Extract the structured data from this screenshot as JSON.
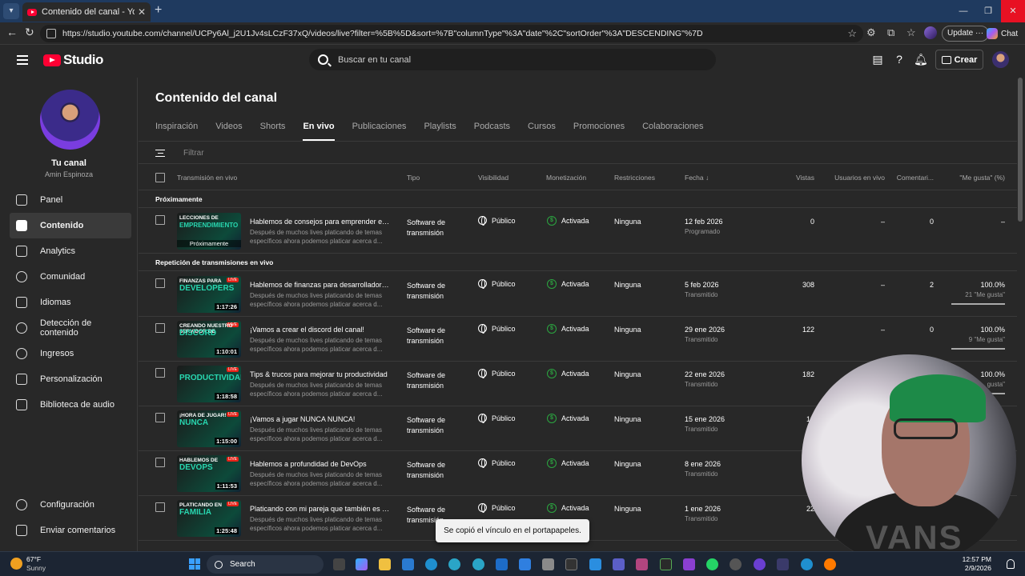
{
  "browser": {
    "tab_title": "Contenido del canal - YouTube Studio",
    "url": "https://studio.youtube.com/channel/UCPy6Al_j2U1Jv4sLCzF37xQ/videos/live?filter=%5B%5D&sort=%7B\"columnType\"%3A\"date\"%2C\"sortOrder\"%3A\"DESCENDING\"%7D",
    "update_label": "Update",
    "chat_label": "Chat"
  },
  "header": {
    "logo": "Studio",
    "search_placeholder": "Buscar en tu canal",
    "create_label": "Crear"
  },
  "sidebar": {
    "channel_title": "Tu canal",
    "channel_name": "Amin Espinoza",
    "items": [
      {
        "label": "Panel",
        "icon": "dashboard-icon"
      },
      {
        "label": "Contenido",
        "icon": "content-icon",
        "active": true
      },
      {
        "label": "Analytics",
        "icon": "analytics-icon"
      },
      {
        "label": "Comunidad",
        "icon": "community-icon"
      },
      {
        "label": "Idiomas",
        "icon": "languages-icon"
      },
      {
        "label": "Detección de contenido",
        "icon": "content-detection-icon"
      },
      {
        "label": "Ingresos",
        "icon": "earn-icon"
      },
      {
        "label": "Personalización",
        "icon": "customization-icon"
      },
      {
        "label": "Biblioteca de audio",
        "icon": "audio-library-icon"
      }
    ],
    "bottom": [
      {
        "label": "Configuración",
        "icon": "settings-icon"
      },
      {
        "label": "Enviar comentarios",
        "icon": "feedback-icon"
      }
    ]
  },
  "main": {
    "title": "Contenido del canal",
    "tabs": [
      "Inspiración",
      "Videos",
      "Shorts",
      "En vivo",
      "Publicaciones",
      "Playlists",
      "Podcasts",
      "Cursos",
      "Promociones",
      "Colaboraciones"
    ],
    "active_tab": "En vivo",
    "filter_placeholder": "Filtrar",
    "columns": [
      "Transmisión en vivo",
      "Tipo",
      "Visibilidad",
      "Monetización",
      "Restricciones",
      "Fecha",
      "Vistas",
      "Usuarios en vivo",
      "Comentari...",
      "\"Me gusta\" (%)"
    ],
    "section_upcoming": "Próximamente",
    "section_replays": "Repetición de transmisiones en vivo",
    "upcoming": [
      {
        "title": "Hablemos de consejos para emprender en...",
        "desc": "Después de muchos lives platicando de temas específicos ahora podemos platicar acerca d...",
        "thumb_top": "LECCIONES DE",
        "thumb_big": "EMPRENDIMIENTO",
        "thumb_badge": "Próximamente",
        "type": "Software de transmisión",
        "visibility": "Público",
        "monetization": "Activada",
        "restrictions": "Ninguna",
        "date": "12 feb 2026",
        "state": "Programado",
        "views": "0",
        "live_users": "–",
        "comments": "0",
        "likes": "–"
      }
    ],
    "replays": [
      {
        "title": "Hablemos de finanzas para desarrolladore...",
        "desc": "Después de muchos lives platicando de temas específicos ahora podemos platicar acerca d...",
        "thumb_top": "FINANZAS PARA",
        "thumb_big": "DEVELOPERS",
        "duration": "1:17:26",
        "type": "Software de transmisión",
        "visibility": "Público",
        "monetization": "Activada",
        "restrictions": "Ninguna",
        "date": "5 feb 2026",
        "state": "Transmitido",
        "views": "308",
        "live_users": "–",
        "comments": "2",
        "likes": "100.0%",
        "likes_sub": "21 \"Me gusta\""
      },
      {
        "title": "¡Vamos a crear el discord del canal!",
        "desc": "Después de muchos lives platicando de temas específicos ahora podemos platicar acerca d...",
        "thumb_top": "CREANDO NUESTRO SERVIDOR DE",
        "thumb_big": "DISCORD",
        "duration": "1:10:01",
        "type": "Software de transmisión",
        "visibility": "Público",
        "monetization": "Activada",
        "restrictions": "Ninguna",
        "date": "29 ene 2026",
        "state": "Transmitido",
        "views": "122",
        "live_users": "–",
        "comments": "0",
        "likes": "100.0%",
        "likes_sub": "9 \"Me gusta\""
      },
      {
        "title": "Tips & trucos para mejorar tu productividad",
        "desc": "Después de muchos lives platicando de temas específicos ahora podemos platicar acerca d...",
        "thumb_top": "",
        "thumb_big": "PRODUCTIVIDAD",
        "duration": "1:18:58",
        "type": "Software de transmisión",
        "visibility": "Público",
        "monetization": "Activada",
        "restrictions": "Ninguna",
        "date": "22 ene 2026",
        "state": "Transmitido",
        "views": "182",
        "live_users": "",
        "comments": "",
        "likes": "100.0%",
        "likes_sub": "gusta\""
      },
      {
        "title": "¡Vamos a jugar NUNCA NUNCA!",
        "desc": "Después de muchos lives platicando de temas específicos ahora podemos platicar acerca d...",
        "thumb_top": "¡HORA DE JUGAR!",
        "thumb_big": "NUNCA",
        "duration": "1:15:00",
        "type": "Software de transmisión",
        "visibility": "Público",
        "monetization": "Activada",
        "restrictions": "Ninguna",
        "date": "15 ene 2026",
        "state": "Transmitido",
        "views": "12",
        "live_users": "",
        "comments": "",
        "likes": "",
        "likes_sub": ""
      },
      {
        "title": "Hablemos a profundidad de DevOps",
        "desc": "Después de muchos lives platicando de temas específicos ahora podemos platicar acerca d...",
        "thumb_top": "HABLEMOS DE",
        "thumb_big": "DEVOPS",
        "duration": "1:11:53",
        "type": "Software de transmisión",
        "visibility": "Público",
        "monetization": "Activada",
        "restrictions": "Ninguna",
        "date": "8 ene 2026",
        "state": "Transmitido",
        "views": "",
        "live_users": "",
        "comments": "",
        "likes": "",
        "likes_sub": ""
      },
      {
        "title": "Platicando con mi pareja que también es d...",
        "desc": "Después de muchos lives platicando de temas específicos ahora podemos platicar acerca d...",
        "thumb_top": "PLATICANDO EN",
        "thumb_big": "FAMILIA",
        "duration": "1:25:48",
        "type": "Software de transmisión",
        "visibility": "Público",
        "monetization": "Activada",
        "restrictions": "Ninguna",
        "date": "1 ene 2026",
        "state": "Transmitido",
        "views": "22",
        "live_users": "",
        "comments": "",
        "likes": "",
        "likes_sub": ""
      }
    ]
  },
  "toast": "Se copió el vínculo en el portapapeles.",
  "webcam_text": "VANS",
  "taskbar": {
    "temp": "67°F",
    "condition": "Sunny",
    "search": "Search",
    "time": "12:57 PM",
    "date": "2/9/2026"
  },
  "colors": {
    "background": "#282828",
    "accent_red": "#ff0033",
    "monetization_green": "#2ba640",
    "thumb_accent": "#28d7b0"
  }
}
